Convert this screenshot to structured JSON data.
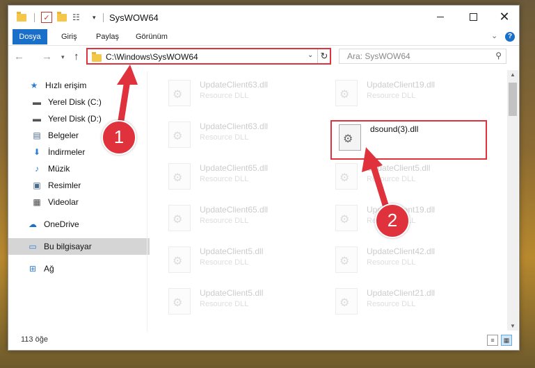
{
  "window": {
    "title": "SysWOW64"
  },
  "ribbon": {
    "tabs": [
      "Dosya",
      "Giriş",
      "Paylaş",
      "Görünüm"
    ]
  },
  "address": {
    "path": "C:\\Windows\\SysWOW64"
  },
  "search": {
    "placeholder": "Ara: SysWOW64"
  },
  "sidebar": {
    "items": [
      {
        "label": "Hızlı erişim",
        "icon": "star-icon"
      },
      {
        "label": "Yerel Disk (C:)",
        "icon": "drive-icon"
      },
      {
        "label": "Yerel Disk (D:)",
        "icon": "drive-icon"
      },
      {
        "label": "Belgeler",
        "icon": "documents-icon"
      },
      {
        "label": "İndirmeler",
        "icon": "download-icon"
      },
      {
        "label": "Müzik",
        "icon": "music-icon"
      },
      {
        "label": "Resimler",
        "icon": "pictures-icon"
      },
      {
        "label": "Videolar",
        "icon": "videos-icon"
      },
      {
        "label": "OneDrive",
        "icon": "cloud-icon"
      },
      {
        "label": "Bu bilgisayar",
        "icon": "computer-icon"
      },
      {
        "label": "Ağ",
        "icon": "network-icon"
      }
    ]
  },
  "files": [
    {
      "name": "UpdateClient63.dll",
      "type": "Resource DLL"
    },
    {
      "name": "UpdateClient19.dll",
      "type": "Resource DLL"
    },
    {
      "name": "UpdateClient63.dll",
      "type": "Resource DLL"
    },
    {
      "name": "dsound(3).dll",
      "type": ""
    },
    {
      "name": "UpdateClient65.dll",
      "type": "Resource DLL"
    },
    {
      "name": "UpdateClient5.dll",
      "type": "Resource DLL"
    },
    {
      "name": "UpdateClient65.dll",
      "type": "Resource DLL"
    },
    {
      "name": "UpdateClient19.dll",
      "type": "Resource DLL"
    },
    {
      "name": "UpdateClient5.dll",
      "type": "Resource DLL"
    },
    {
      "name": "UpdateClient42.dll",
      "type": "Resource DLL"
    },
    {
      "name": "UpdateClient5.dll",
      "type": "Resource DLL"
    },
    {
      "name": "UpdateClient21.dll",
      "type": "Resource DLL"
    }
  ],
  "status": {
    "count": "113 öğe"
  },
  "callouts": [
    "1",
    "2"
  ],
  "accent": "#1a6fc9",
  "highlight_color": "#e0323c"
}
